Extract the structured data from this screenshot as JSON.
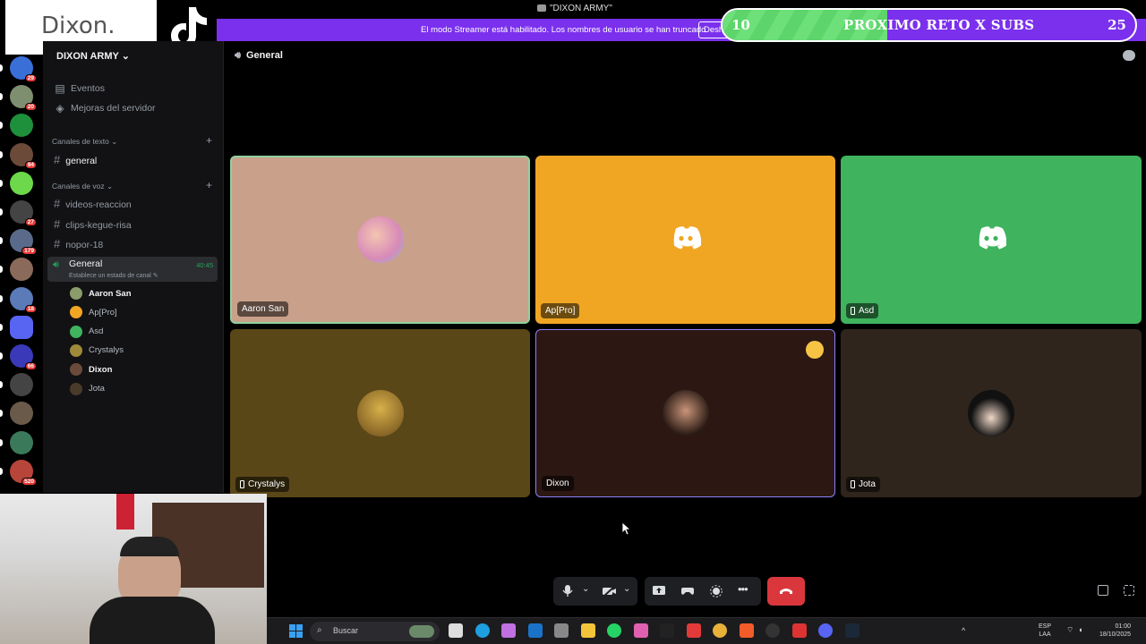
{
  "window": {
    "title": "\"DIXON ARMY\""
  },
  "banner": {
    "text": "El modo Streamer está habilitado. Los nombres de usuario se han truncado.",
    "button": "Desh"
  },
  "subs_goal": {
    "current": "10",
    "label": "PROXIMO RETO X SUBS",
    "target": "25",
    "progress": 0.4
  },
  "logo": {
    "text": "Dixon."
  },
  "server": {
    "name": "DIXON ARMY",
    "rail_badges": [
      "29",
      "20",
      "",
      "94",
      "",
      "27",
      "179",
      "",
      "18",
      "",
      "66",
      "",
      "",
      "",
      "520"
    ],
    "menu": [
      {
        "label": "Eventos"
      },
      {
        "label": "Mejoras del servidor"
      }
    ],
    "text_category": "Canales de texto",
    "text_channels": [
      {
        "name": "general"
      }
    ],
    "voice_category": "Canales de voz",
    "voice_text_channels": [
      {
        "name": "videos-reaccion"
      },
      {
        "name": "clips-kegue-risa"
      },
      {
        "name": "nopor-18"
      }
    ],
    "voice_channel": {
      "name": "General",
      "timer": "40:45",
      "status_placeholder": "Establece un estado de canal"
    },
    "voice_users": [
      {
        "name": "Aaron San"
      },
      {
        "name": "Ap[Pro]"
      },
      {
        "name": "Asd"
      },
      {
        "name": "Crystalys"
      },
      {
        "name": "Dixon"
      },
      {
        "name": "Jota"
      }
    ]
  },
  "call": {
    "channel": "General",
    "tiles": [
      {
        "name": "Aaron San",
        "bg": "#c9a08a",
        "mobile": false
      },
      {
        "name": "Ap[Pro]",
        "bg": "#f0a623",
        "mobile": false
      },
      {
        "name": "Asd",
        "bg": "#3fb35e",
        "mobile": true
      },
      {
        "name": "Crystalys",
        "bg": "#5a4718",
        "mobile": true
      },
      {
        "name": "Dixon",
        "bg": "#2c1712",
        "mobile": false
      },
      {
        "name": "Jota",
        "bg": "#2f251c",
        "mobile": true
      }
    ]
  },
  "taskbar": {
    "search_placeholder": "Buscar",
    "lang": "ESP",
    "region": "LAA",
    "time": "01:00",
    "date": "18/10/2025"
  }
}
